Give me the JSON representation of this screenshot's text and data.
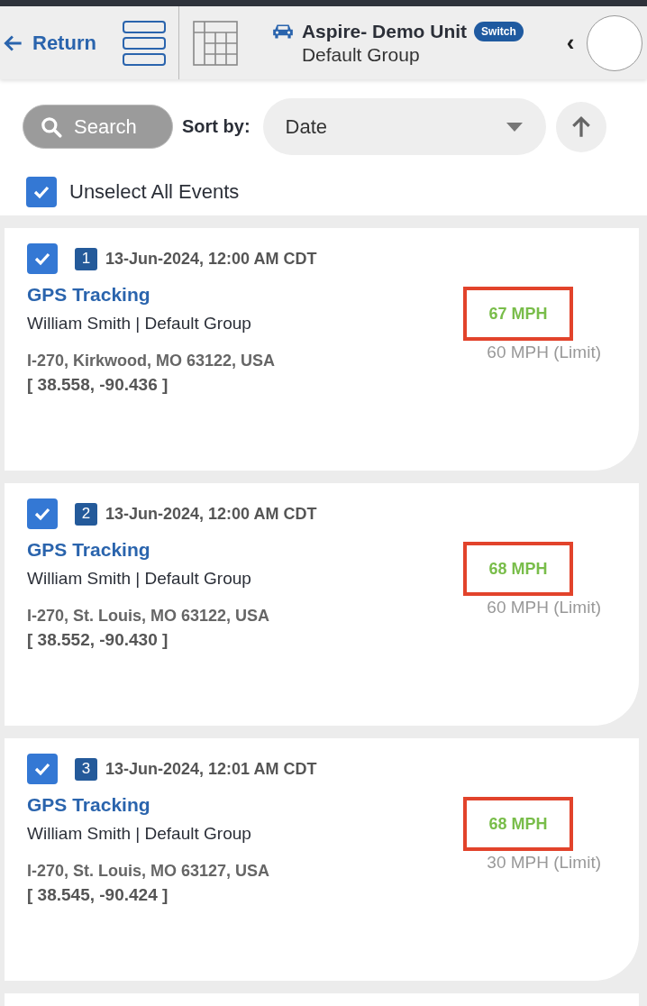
{
  "header": {
    "return_label": "Return",
    "unit_name": "Aspire- Demo Unit",
    "switch_label": "Switch",
    "group": "Default Group",
    "collapse_glyph": "‹"
  },
  "toolbar": {
    "search_label": "Search",
    "sort_label": "Sort by:",
    "sort_value": "Date"
  },
  "select_all": {
    "label": "Unselect All Events",
    "checked": true
  },
  "events": [
    {
      "checked": true,
      "index": "1",
      "datetime": "13-Jun-2024, 12:00 AM CDT",
      "type": "GPS Tracking",
      "driver_group": "William Smith | Default Group",
      "address": "I-270, Kirkwood, MO 63122, USA",
      "coords": "[ 38.558, -90.436 ]",
      "speed": "67 MPH",
      "limit": "60 MPH (Limit)",
      "flagged": true
    },
    {
      "checked": true,
      "index": "2",
      "datetime": "13-Jun-2024, 12:00 AM CDT",
      "type": "GPS Tracking",
      "driver_group": "William Smith | Default Group",
      "address": "I-270, St. Louis, MO 63122, USA",
      "coords": "[ 38.552, -90.430 ]",
      "speed": "68 MPH",
      "limit": "60 MPH (Limit)",
      "flagged": true
    },
    {
      "checked": true,
      "index": "3",
      "datetime": "13-Jun-2024, 12:01 AM CDT",
      "type": "GPS Tracking",
      "driver_group": "William Smith | Default Group",
      "address": "I-270, St. Louis, MO 63127, USA",
      "coords": "[ 38.545, -90.424 ]",
      "speed": "68 MPH",
      "limit": "30 MPH (Limit)",
      "flagged": true
    }
  ]
}
